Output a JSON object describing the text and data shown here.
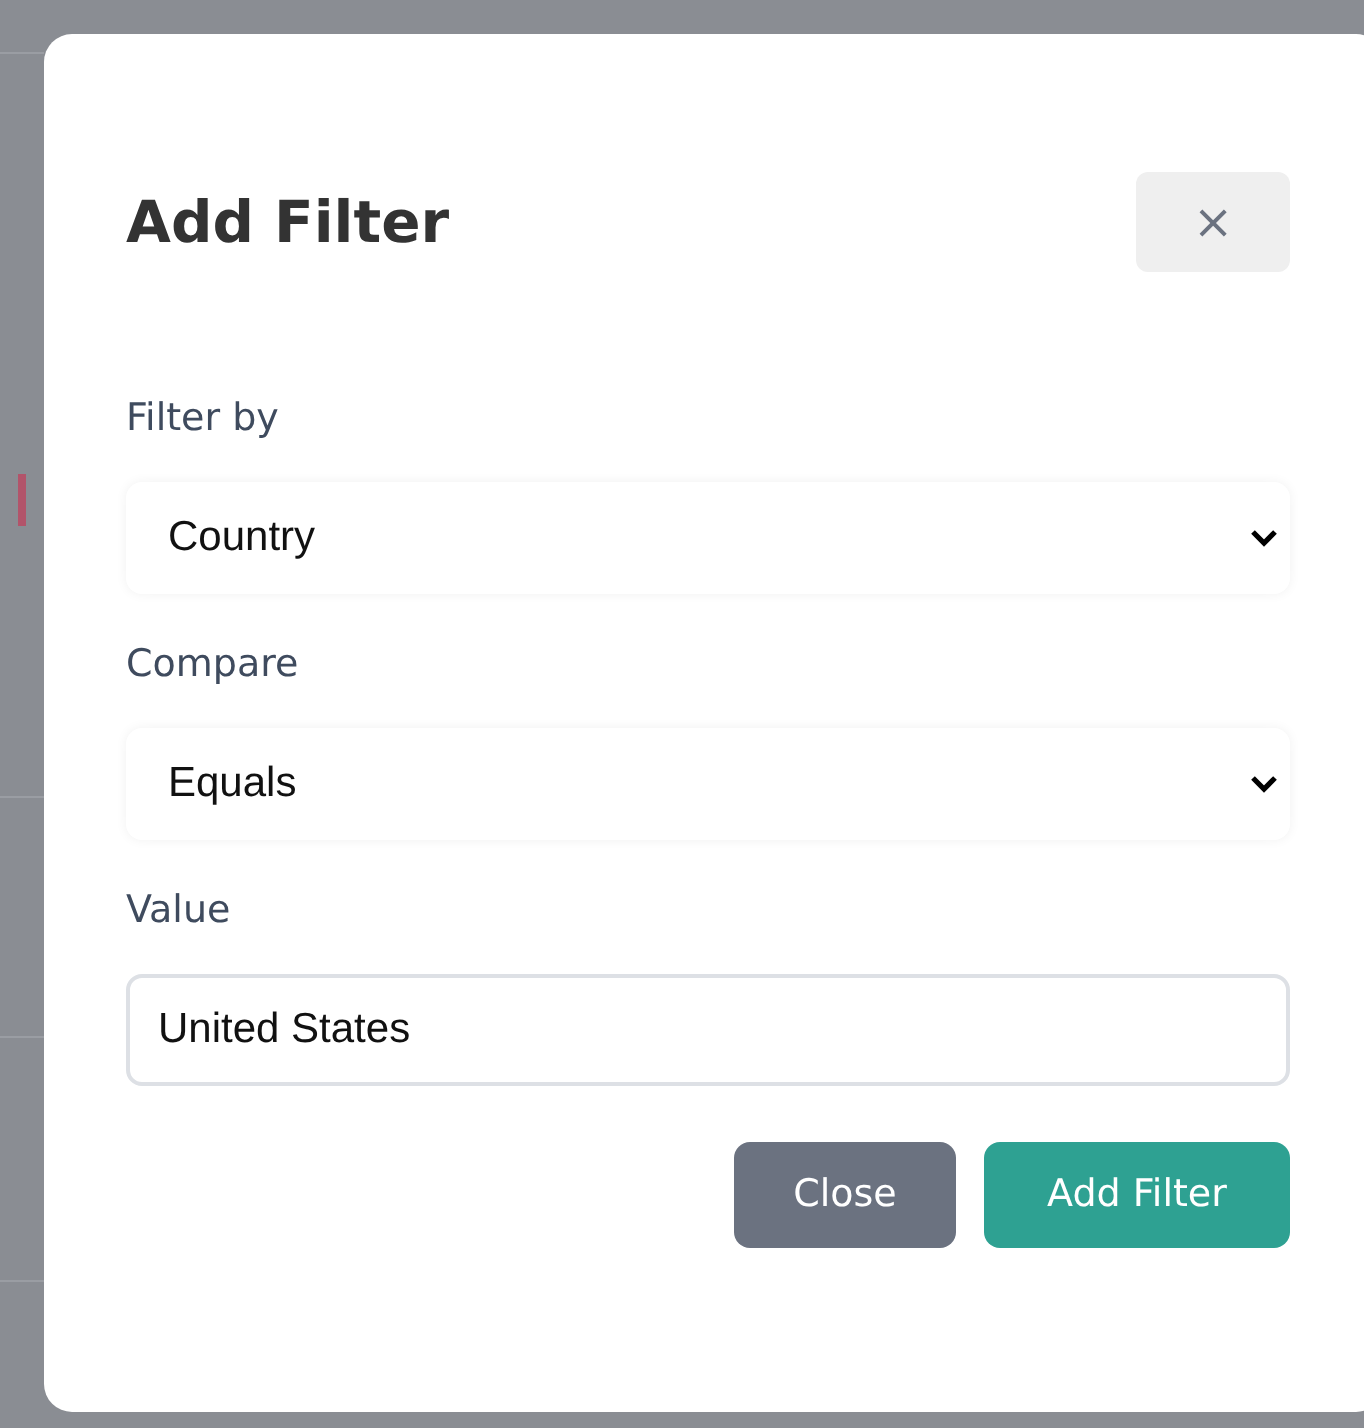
{
  "dialog": {
    "title": "Add Filter",
    "close_symbol": "×"
  },
  "fields": [
    {
      "kind": "select",
      "label": "Filter by",
      "value": "Country"
    },
    {
      "kind": "select",
      "label": "Compare",
      "value": "Equals"
    },
    {
      "kind": "text",
      "label": "Value",
      "value": "United States"
    }
  ],
  "buttons": [
    {
      "label": "Close",
      "kind": "secondary"
    },
    {
      "label": "Add Filter",
      "kind": "primary"
    }
  ]
}
